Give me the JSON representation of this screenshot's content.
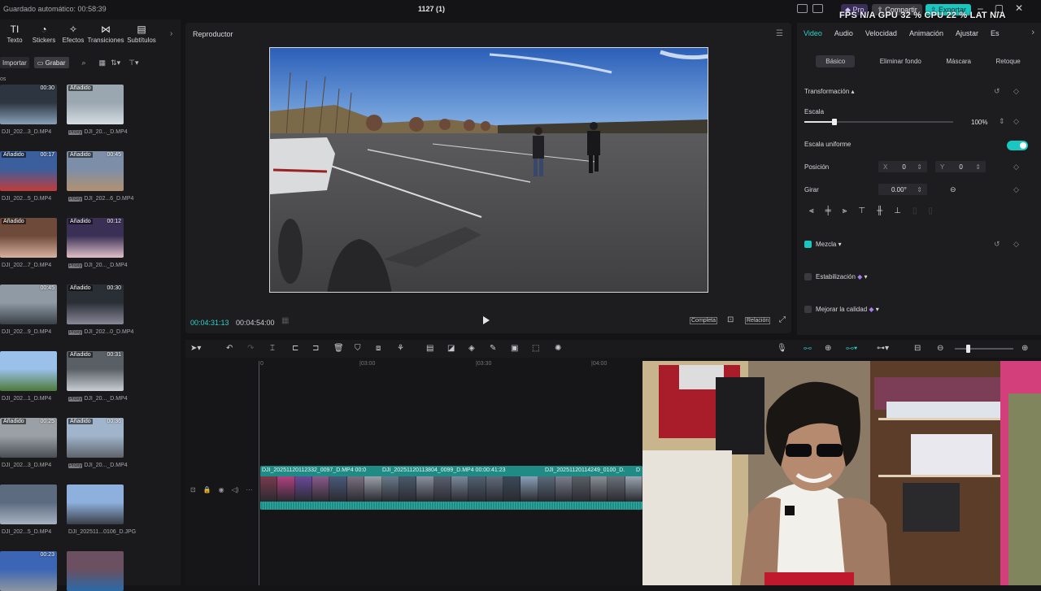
{
  "titlebar": {
    "autosave": "Guardado automático: 00:58:39",
    "project_title": "1127 (1)",
    "pro_label": "Pro",
    "share_label": "Compartir",
    "export_label": "Exportar",
    "overlay_stats": "FPS N/A  GPU 32 %  CPU 22 %  LAT N/A"
  },
  "tools": [
    {
      "icon": "text-icon",
      "glyph": "TI",
      "label": "Texto"
    },
    {
      "icon": "sticker-icon",
      "glyph": "◔",
      "label": "Stickers"
    },
    {
      "icon": "effects-icon",
      "glyph": "✧",
      "label": "Efectos"
    },
    {
      "icon": "transitions-icon",
      "glyph": "⋈",
      "label": "Transiciones"
    },
    {
      "icon": "subtitles-icon",
      "glyph": "▤",
      "label": "Subtítulos"
    }
  ],
  "media": {
    "import_label": "Importar",
    "record_label": "Grabar",
    "section_label": "os",
    "items": [
      {
        "name": "DJI_202...3_D.MP4",
        "duration": "00:30",
        "added": false,
        "proxy": false
      },
      {
        "name": "DJI_20..._D.MP4",
        "duration": "",
        "added": true,
        "proxy": true
      },
      {
        "name": "DJI_202...5_D.MP4",
        "duration": "00:17",
        "added": true,
        "proxy": false
      },
      {
        "name": "DJI_202...6_D.MP4",
        "duration": "00:45",
        "added": true,
        "proxy": true
      },
      {
        "name": "DJI_202...7_D.MP4",
        "duration": "",
        "added": true,
        "proxy": false
      },
      {
        "name": "DJI_20..._D.MP4",
        "duration": "00:12",
        "added": true,
        "proxy": true
      },
      {
        "name": "DJI_202...9_D.MP4",
        "duration": "00:45",
        "added": false,
        "proxy": false
      },
      {
        "name": "DJI_202...0_D.MP4",
        "duration": "00:30",
        "added": true,
        "proxy": true
      },
      {
        "name": "DJI_202...1_D.MP4",
        "duration": "",
        "added": false,
        "proxy": false
      },
      {
        "name": "DJI_20..._D.MP4",
        "duration": "00:31",
        "added": true,
        "proxy": true
      },
      {
        "name": "DJI_202...3_D.MP4",
        "duration": "00:25",
        "added": true,
        "proxy": false
      },
      {
        "name": "DJI_20..._D.MP4",
        "duration": "00:36",
        "added": true,
        "proxy": true
      },
      {
        "name": "DJI_202...5_D.MP4",
        "duration": "",
        "added": false,
        "proxy": false
      },
      {
        "name": "DJI_202511...0106_D.JPG",
        "duration": "",
        "added": false,
        "proxy": false
      },
      {
        "name": "",
        "duration": "00:23",
        "added": false,
        "proxy": false
      },
      {
        "name": "",
        "duration": "",
        "added": false,
        "proxy": false
      }
    ]
  },
  "player": {
    "header": "Reproductor",
    "time_current": "00:04:31:13",
    "time_total": "00:04:54:00",
    "full_label": "Completa",
    "ratio_label": "Relación"
  },
  "inspector": {
    "tabs": [
      "Video",
      "Audio",
      "Velocidad",
      "Animación",
      "Ajustar",
      "Es"
    ],
    "active_tab": "Video",
    "subtabs": [
      "Básico",
      "Eliminar fondo",
      "Máscara",
      "Retoque"
    ],
    "transform_label": "Transformación",
    "scale_label": "Escala",
    "scale_value": "100%",
    "scale_fraction": 0.2,
    "uniform_label": "Escala uniforme",
    "uniform_on": true,
    "position_label": "Posición",
    "pos_x_label": "X",
    "pos_x": "0",
    "pos_y_label": "Y",
    "pos_y": "0",
    "rotate_label": "Girar",
    "rotate_value": "0.00°",
    "blend_label": "Mezcla",
    "stabilize_label": "Estabilización",
    "enhance_label": "Mejorar la calidad"
  },
  "timeline": {
    "ruler": [
      "0",
      "|03:00",
      "|03:30",
      "|04:00"
    ],
    "clips": [
      {
        "label": "DJI_20251120112332_0097_D.MP4  00:0"
      },
      {
        "label": "DJI_20251120113804_0099_D.MP4   00:00:41:23"
      },
      {
        "label": "DJI_20251120114249_0100_D."
      },
      {
        "label": "D"
      }
    ]
  },
  "colors": {
    "accent": "#19c6c0",
    "pro": "#3a2f55",
    "bg": "#141416",
    "panel": "#1d1d20"
  }
}
